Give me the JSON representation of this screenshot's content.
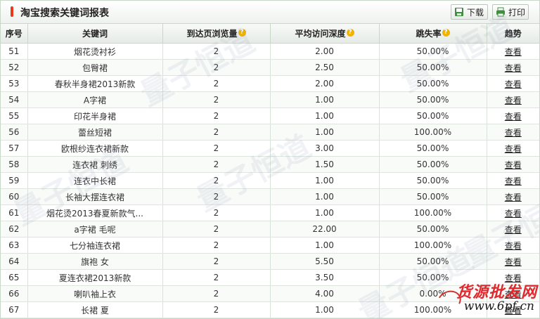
{
  "header": {
    "title": "淘宝搜索关键词报表",
    "download_label": "下载",
    "print_label": "打印"
  },
  "table": {
    "columns": [
      "序号",
      "关键词",
      "到达页浏览量",
      "平均访问深度",
      "跳失率",
      "趋势"
    ],
    "help_marker": "?",
    "view_label": "查看",
    "rows": [
      {
        "seq": "51",
        "keyword": "烟花烫衬衫",
        "views": "2",
        "depth": "2.00",
        "bounce": "50.00%"
      },
      {
        "seq": "52",
        "keyword": "包臀裙",
        "views": "2",
        "depth": "2.50",
        "bounce": "50.00%"
      },
      {
        "seq": "53",
        "keyword": "春秋半身裙2013新款",
        "views": "2",
        "depth": "2.00",
        "bounce": "50.00%"
      },
      {
        "seq": "54",
        "keyword": "A字裙",
        "views": "2",
        "depth": "1.00",
        "bounce": "50.00%"
      },
      {
        "seq": "55",
        "keyword": "印花半身裙",
        "views": "2",
        "depth": "1.00",
        "bounce": "50.00%"
      },
      {
        "seq": "56",
        "keyword": "蕾丝短裙",
        "views": "2",
        "depth": "1.00",
        "bounce": "100.00%"
      },
      {
        "seq": "57",
        "keyword": "欧根纱连衣裙新款",
        "views": "2",
        "depth": "3.00",
        "bounce": "50.00%"
      },
      {
        "seq": "58",
        "keyword": "连衣裙 刺绣",
        "views": "2",
        "depth": "1.50",
        "bounce": "50.00%"
      },
      {
        "seq": "59",
        "keyword": "连衣中长裙",
        "views": "2",
        "depth": "1.00",
        "bounce": "50.00%"
      },
      {
        "seq": "60",
        "keyword": "长袖大摆连衣裙",
        "views": "2",
        "depth": "1.00",
        "bounce": "50.00%"
      },
      {
        "seq": "61",
        "keyword": "烟花烫2013春夏新款气...",
        "views": "2",
        "depth": "1.00",
        "bounce": "100.00%"
      },
      {
        "seq": "62",
        "keyword": "a字裙 毛呢",
        "views": "2",
        "depth": "22.00",
        "bounce": "50.00%"
      },
      {
        "seq": "63",
        "keyword": "七分袖连衣裙",
        "views": "2",
        "depth": "1.00",
        "bounce": "100.00%"
      },
      {
        "seq": "64",
        "keyword": "旗袍 女",
        "views": "2",
        "depth": "5.50",
        "bounce": "50.00%"
      },
      {
        "seq": "65",
        "keyword": "夏连衣裙2013新款",
        "views": "2",
        "depth": "3.50",
        "bounce": "50.00%"
      },
      {
        "seq": "66",
        "keyword": "喇叭袖上衣",
        "views": "2",
        "depth": "4.00",
        "bounce": "0.00%"
      },
      {
        "seq": "67",
        "keyword": "长裙 夏",
        "views": "2",
        "depth": "1.00",
        "bounce": "100.00%"
      }
    ]
  },
  "watermark": {
    "text": "量子恒道"
  },
  "corner_logo": {
    "main": "货源批发网",
    "sub": "www.6pf.cn"
  },
  "colors": {
    "title_marker": "#e8391a",
    "help_icon": "#f0b400",
    "border": "#c8d8c8",
    "logo_red": "#e0282d"
  }
}
